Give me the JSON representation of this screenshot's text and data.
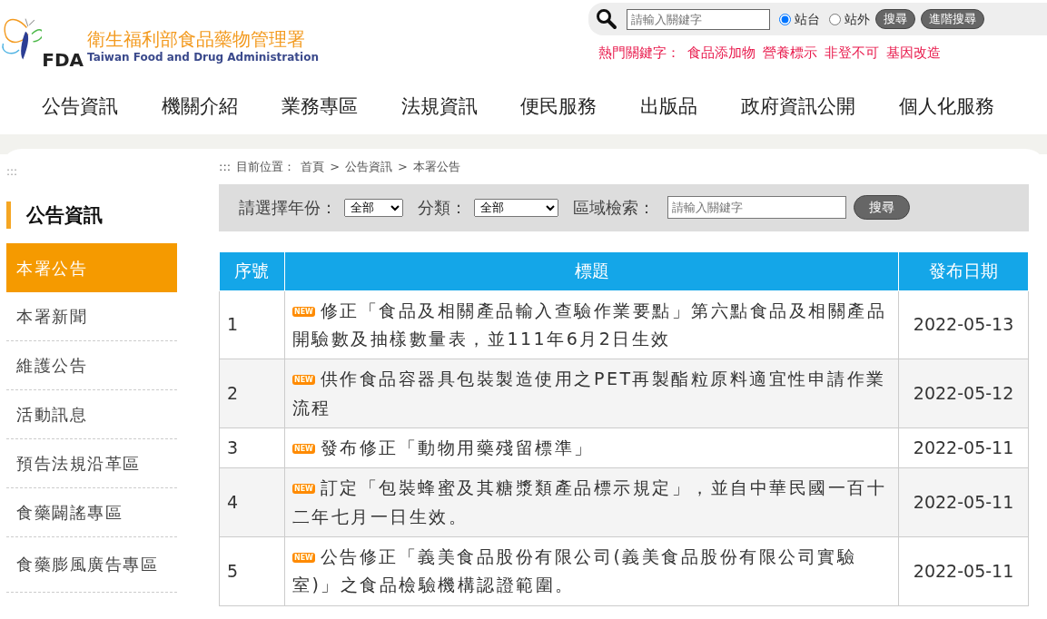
{
  "header": {
    "logo_title": "衛生福利部食品藥物管理署",
    "logo_subtitle": "Taiwan Food and Drug Administration",
    "logo_mark": "FDA",
    "search": {
      "placeholder": "請輸入關鍵字",
      "scopes": [
        {
          "label": "站台",
          "selected": true
        },
        {
          "label": "站外",
          "selected": false
        }
      ],
      "buttons": [
        "搜尋",
        "進階搜尋"
      ]
    },
    "hot_keywords": {
      "label": "熱門關鍵字：",
      "items": [
        "食品添加物",
        "營養標示",
        "非登不可",
        "基因改造"
      ]
    }
  },
  "nav": [
    "公告資訊",
    "機關介紹",
    "業務專區",
    "法規資訊",
    "便民服務",
    "出版品",
    "政府資訊公開",
    "個人化服務"
  ],
  "sidebar": {
    "marker": ":::",
    "title": "公告資訊",
    "items": [
      {
        "label": "本署公告",
        "selected": true
      },
      {
        "label": "本署新聞",
        "selected": false
      },
      {
        "label": "維護公告",
        "selected": false
      },
      {
        "label": "活動訊息",
        "selected": false
      },
      {
        "label": "預告法規沿革區",
        "selected": false
      },
      {
        "label": "食藥闢謠專區",
        "selected": false
      },
      {
        "label": "食藥膨風廣告專區",
        "selected": false
      }
    ]
  },
  "breadcrumb": {
    "marker": ":::",
    "label": "目前位置：",
    "items": [
      "首頁",
      "公告資訊",
      "本署公告"
    ],
    "separator": ">"
  },
  "filter": {
    "year_label": "請選擇年份：",
    "year_value": "全部",
    "category_label": "分類：",
    "category_value": "全部",
    "search_label": "區域檢索：",
    "search_placeholder": "請輸入關鍵字",
    "button": "搜尋"
  },
  "table": {
    "columns": [
      "序號",
      "標題",
      "發布日期"
    ],
    "rows": [
      {
        "no": "1",
        "badge": "NEW",
        "title": "修正「食品及相關產品輸入查驗作業要點」第六點食品及相關產品開驗數及抽樣數量表，並111年6月2日生效",
        "date": "2022-05-13"
      },
      {
        "no": "2",
        "badge": "NEW",
        "title": "供作食品容器具包裝製造使用之PET再製酯粒原料適宜性申請作業流程",
        "date": "2022-05-12"
      },
      {
        "no": "3",
        "badge": "NEW",
        "title": "發布修正「動物用藥殘留標準」",
        "date": "2022-05-11"
      },
      {
        "no": "4",
        "badge": "NEW",
        "title": "訂定「包裝蜂蜜及其糖漿類產品標示規定」，並自中華民國一百十二年七月一日生效。",
        "date": "2022-05-11"
      },
      {
        "no": "5",
        "badge": "NEW",
        "title": "公告修正「義美食品股份有限公司(義美食品股份有限公司實驗室)」之食品檢驗機構認證範圍。",
        "date": "2022-05-11"
      }
    ]
  }
}
